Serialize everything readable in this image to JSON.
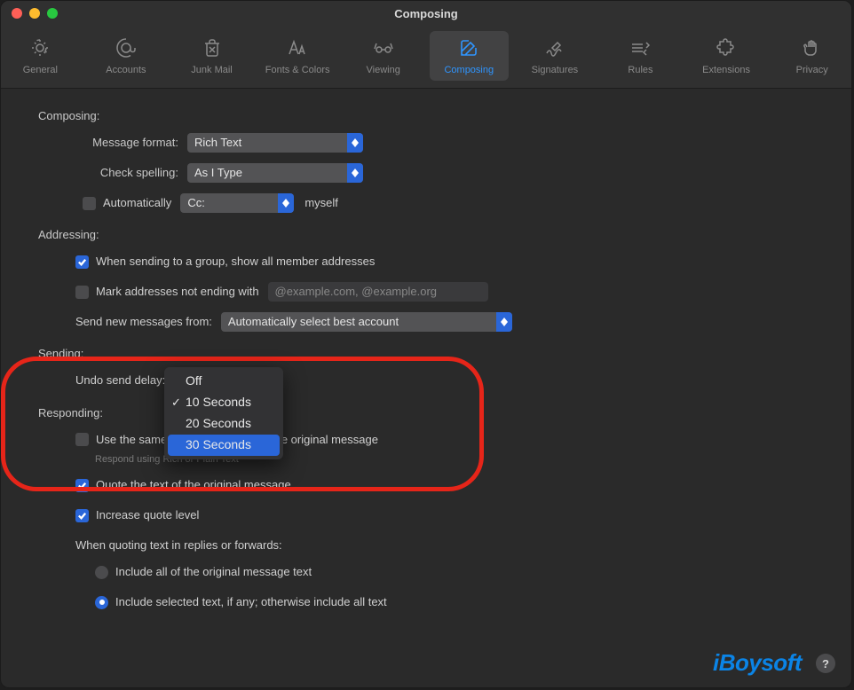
{
  "window": {
    "title": "Composing"
  },
  "tabs": [
    {
      "label": "General"
    },
    {
      "label": "Accounts"
    },
    {
      "label": "Junk Mail"
    },
    {
      "label": "Fonts & Colors"
    },
    {
      "label": "Viewing"
    },
    {
      "label": "Composing"
    },
    {
      "label": "Signatures"
    },
    {
      "label": "Rules"
    },
    {
      "label": "Extensions"
    },
    {
      "label": "Privacy"
    }
  ],
  "composing": {
    "heading": "Composing:",
    "message_format_label": "Message format:",
    "message_format_value": "Rich Text",
    "check_spelling_label": "Check spelling:",
    "check_spelling_value": "As I Type",
    "auto_cc_checkbox_label": "Automatically",
    "auto_cc_select_value": "Cc:",
    "auto_cc_suffix": "myself"
  },
  "addressing": {
    "heading": "Addressing:",
    "group_addresses_label": "When sending to a group, show all member addresses",
    "mark_addresses_label": "Mark addresses not ending with",
    "mark_addresses_placeholder": "@example.com, @example.org",
    "send_from_label": "Send new messages from:",
    "send_from_value": "Automatically select best account"
  },
  "sending": {
    "heading": "Sending:",
    "undo_delay_label": "Undo send delay:",
    "undo_delay_menu": {
      "options": [
        "Off",
        "10 Seconds",
        "20 Seconds",
        "30 Seconds"
      ],
      "checked": "10 Seconds",
      "highlighted": "30 Seconds"
    }
  },
  "responding": {
    "heading": "Responding:",
    "same_format_label": "Use the same message format as the original message",
    "same_format_hint": "Respond using Rich or Plain Text",
    "quote_original_label": "Quote the text of the original message",
    "increase_quote_label": "Increase quote level",
    "when_quoting_label": "When quoting text in replies or forwards:",
    "include_all_label": "Include all of the original message text",
    "include_selected_label": "Include selected text, if any; otherwise include all text"
  },
  "watermark": "iBoysoft",
  "help": "?"
}
